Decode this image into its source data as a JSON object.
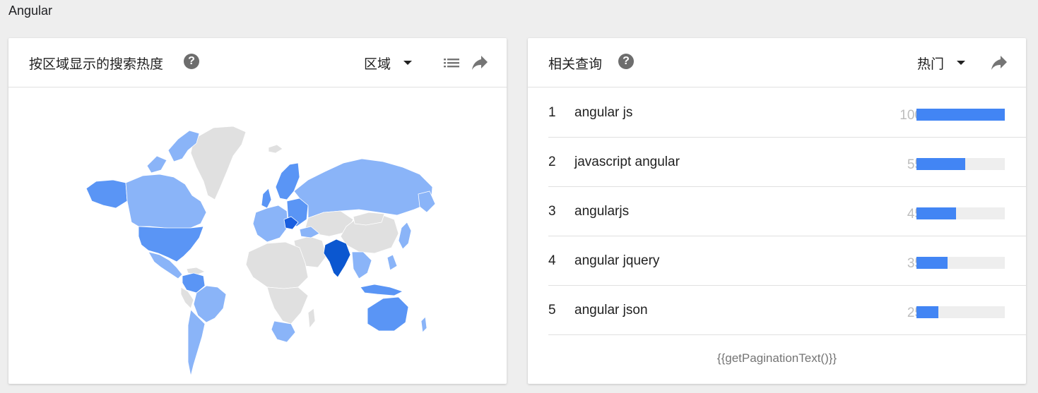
{
  "page": {
    "title": "Angular"
  },
  "colors": {
    "accent": "#4285f4",
    "map_low": "#8ab4f8",
    "map_mid": "#5a95f5",
    "map_high": "#1a5fe0",
    "map_top": "#0b57d0",
    "map_none": "#e0e0e0"
  },
  "region_card": {
    "title": "按区域显示的搜索热度",
    "help_icon": "help-icon",
    "dropdown_label": "区域",
    "list_icon": "list-icon",
    "share_icon": "share-icon"
  },
  "related_card": {
    "title": "相关查询",
    "help_icon": "help-icon",
    "dropdown_label": "热门",
    "share_icon": "share-icon",
    "rows": [
      {
        "rank": "1",
        "query": "angular js",
        "value": "100",
        "percent": 100
      },
      {
        "rank": "2",
        "query": "javascript angular",
        "value": "55",
        "percent": 55
      },
      {
        "rank": "3",
        "query": "angularjs",
        "value": "45",
        "percent": 45
      },
      {
        "rank": "4",
        "query": "angular jquery",
        "value": "35",
        "percent": 35
      },
      {
        "rank": "5",
        "query": "angular json",
        "value": "25",
        "percent": 25
      }
    ],
    "pagination_text": "{{getPaginationText()}}"
  }
}
